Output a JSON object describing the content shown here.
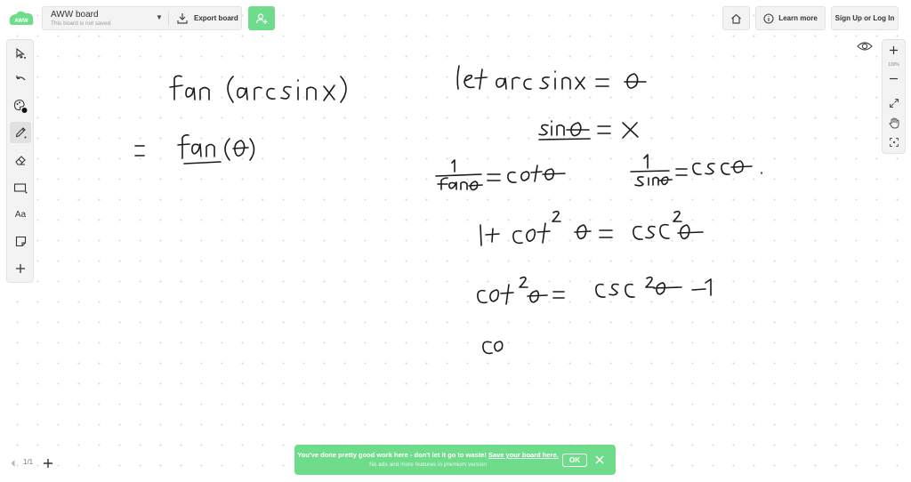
{
  "header": {
    "board_title": "AWW board",
    "board_subtitle": "This board is not saved",
    "export_label": "Export board",
    "learn_more_label": "Learn more",
    "signup_label": "Sign Up or Log In"
  },
  "toolbar": {
    "items": [
      "select",
      "undo",
      "color",
      "pen",
      "eraser",
      "shape",
      "text",
      "sticky-note",
      "add"
    ],
    "text_tool_label": "Aa",
    "active_tool": "pen"
  },
  "zoom": {
    "level": "100%"
  },
  "pagination": {
    "label": "1/1"
  },
  "banner": {
    "message": "You've done pretty good work here - don't let it go to waste!",
    "link": "Save your board here.",
    "sub": "No ads and more features in premium version",
    "ok_label": "OK"
  },
  "colors": {
    "accent": "#6fdc8c",
    "ink": "#1a1a1a"
  }
}
